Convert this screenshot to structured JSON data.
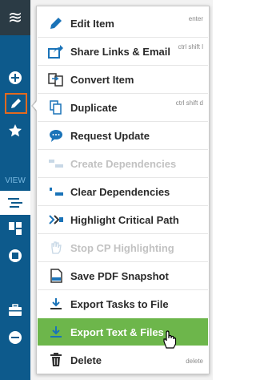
{
  "colors": {
    "rail": "#0d5a8c",
    "rail_header": "#2b3b45",
    "accent_orange": "#e26a1f",
    "highlight_green": "#6db64b",
    "icon_blue": "#1a73b8"
  },
  "rail": {
    "view_label": "VIEW"
  },
  "menu": {
    "items": [
      {
        "label": "Edit Item",
        "shortcut": "enter",
        "icon": "pencil-icon"
      },
      {
        "label": "Share Links & Email",
        "shortcut": "ctrl shift l",
        "icon": "share-arrow-icon"
      },
      {
        "label": "Convert Item",
        "shortcut": "",
        "icon": "convert-icon"
      },
      {
        "label": "Duplicate",
        "shortcut": "ctrl shift d",
        "icon": "duplicate-icon"
      },
      {
        "label": "Request Update",
        "shortcut": "",
        "icon": "chat-bubble-icon"
      },
      {
        "label": "Create Dependencies",
        "shortcut": "",
        "icon": "create-dependencies-icon",
        "disabled": true
      },
      {
        "label": "Clear Dependencies",
        "shortcut": "",
        "icon": "clear-dependencies-icon"
      },
      {
        "label": "Highlight Critical Path",
        "shortcut": "",
        "icon": "critical-path-icon"
      },
      {
        "label": "Stop CP Highlighting",
        "shortcut": "",
        "icon": "stop-hand-icon",
        "disabled": true
      },
      {
        "label": "Save PDF Snapshot",
        "shortcut": "",
        "icon": "pdf-icon"
      },
      {
        "label": "Export Tasks to File",
        "shortcut": "",
        "icon": "export-download-icon"
      },
      {
        "label": "Export Text & Files",
        "shortcut": "",
        "icon": "export-download-icon",
        "highlighted": true
      },
      {
        "label": "Delete",
        "shortcut": "delete",
        "icon": "trash-icon"
      }
    ]
  }
}
